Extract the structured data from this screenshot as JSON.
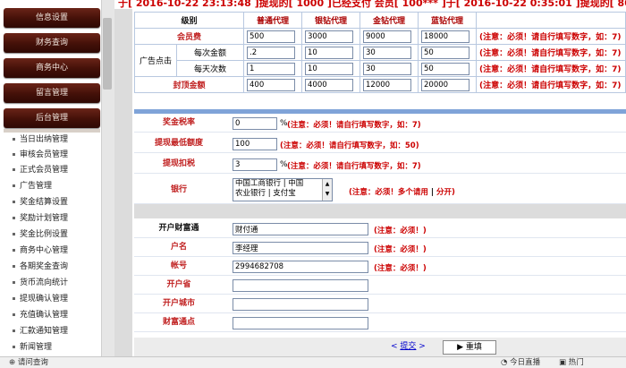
{
  "marquee": "于[ 2016-10-22 23:13:48 ]提现的[ 1000 ]已经支付 会员[ 100*** ]于[ 2016-10-22 0:35:01 ]提现的[ 800 ]已经",
  "sidebar": {
    "menu": [
      "信息设置",
      "财务查询",
      "商务中心",
      "留言管理",
      "后台管理"
    ],
    "items": [
      "当日出纳管理",
      "审核会员管理",
      "正式会员管理",
      "广告管理",
      "奖金结算设置",
      "奖励计划管理",
      "奖金比例设置",
      "商务中心管理",
      "各期奖金查询",
      "货币流向统计",
      "提现确认管理",
      "充值确认管理",
      "汇款通知管理",
      "新闻管理"
    ]
  },
  "grid": {
    "headers": [
      "级别",
      "普通代理",
      "银钻代理",
      "金钻代理",
      "蓝钻代理"
    ],
    "member_fee_label": "会员费",
    "member_fee": [
      "500",
      "3000",
      "9000",
      "18000"
    ],
    "ad_label": "广告点击",
    "per_amount_label": "每次金额",
    "per_amount": [
      ".2",
      "10",
      "30",
      "50"
    ],
    "daily_count_label": "每天次数",
    "daily_count": [
      "1",
      "10",
      "30",
      "50"
    ],
    "cap_label": "封顶金额",
    "cap": [
      "400",
      "4000",
      "12000",
      "20000"
    ],
    "note": "(注意：必须！请自行填写数字，如：7)"
  },
  "settings": {
    "bonus_tax_label": "奖金税率",
    "bonus_tax": "0",
    "bonus_tax_unit": "%",
    "bonus_tax_note": "(注意：必须！请自行填写数字，如：7)",
    "min_withdraw_label": "提现最低额度",
    "min_withdraw": "100",
    "min_withdraw_note": "(注意：必须！请自行填写数字，如：50)",
    "withdraw_fee_label": "提现扣税",
    "withdraw_fee": "3",
    "withdraw_fee_unit": "%",
    "withdraw_fee_note": "(注意：必须！请自行填写数字，如：7)",
    "bank_label": "银行",
    "bank_options": [
      "中国工商银行 | 中国",
      "农业银行 | 支付宝"
    ],
    "bank_note_prefix": "(注意：必须！多个请用",
    "bank_note_sep": "|",
    "bank_note_suffix": "分开)"
  },
  "account": {
    "open_label": "开户财富通",
    "open_value": "财付通",
    "open_note": "(注意：必须！)",
    "name_label": "户名",
    "name_value": "李经理",
    "name_note": "(注意：必须！)",
    "number_label": "帐号",
    "number_value": "2994682708",
    "number_note": "(注意：必须！)",
    "province_label": "开户省",
    "city_label": "开户城市",
    "branch_label": "财富通点"
  },
  "buttons": {
    "submit": "提交",
    "reset": "重填"
  },
  "statusbar": {
    "left": "请问查询",
    "right1": "今日直播",
    "right2": "热门"
  }
}
